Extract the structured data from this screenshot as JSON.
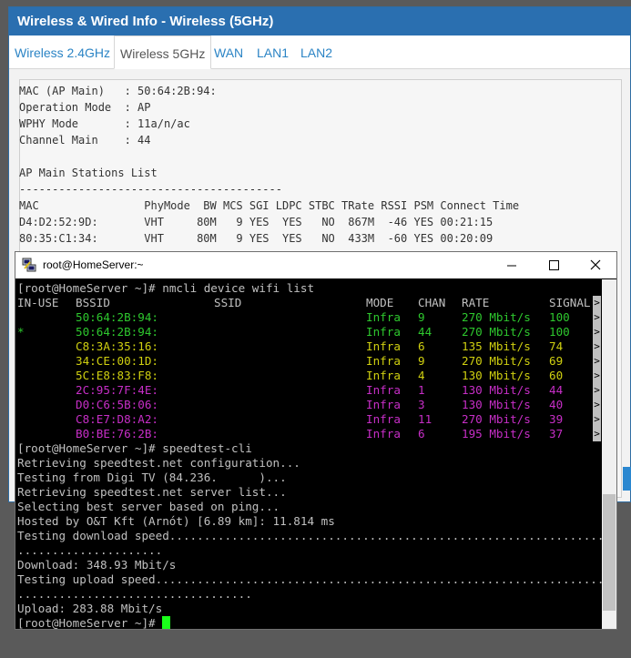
{
  "router": {
    "title": "Wireless & Wired Info - Wireless (5GHz)",
    "tabs": [
      {
        "label": "Wireless 2.4GHz"
      },
      {
        "label": "Wireless 5GHz"
      },
      {
        "label": "WAN"
      },
      {
        "label": "LAN1"
      },
      {
        "label": "LAN2"
      }
    ],
    "active_tab": "Wireless 5GHz",
    "lines": [
      "MAC (AP Main)   : 50:64:2B:94:",
      "Operation Mode  : AP",
      "WPHY Mode       : 11a/n/ac",
      "Channel Main    : 44",
      "",
      "AP Main Stations List",
      "----------------------------------------",
      "MAC                PhyMode  BW MCS SGI LDPC STBC TRate RSSI PSM Connect Time",
      "D4:D2:52:9D:       VHT     80M   9 YES  YES   NO  867M  -46 YES 00:21:15",
      "80:35:C1:34:       VHT     80M   9 YES  YES   NO  433M  -60 YES 00:20:09"
    ]
  },
  "terminal": {
    "title": "root@HomeServer:~",
    "prompt": "[root@HomeServer ~]# ",
    "command1": "nmcli device wifi list",
    "headers": {
      "inuse": "IN-USE",
      "bssid": "BSSID",
      "ssid": "SSID",
      "mode": "MODE",
      "chan": "CHAN",
      "rate": "RATE",
      "signal": "SIGNAL"
    },
    "networks": [
      {
        "inuse": "",
        "bssid": "50:64:2B:94:",
        "mode": "Infra",
        "chan": "9",
        "rate": "270 Mbit/s",
        "signal": "100",
        "color": "#2ec82e"
      },
      {
        "inuse": "*",
        "bssid": "50:64:2B:94:",
        "mode": "Infra",
        "chan": "44",
        "rate": "270 Mbit/s",
        "signal": "100",
        "color": "#2ec82e"
      },
      {
        "inuse": "",
        "bssid": "C8:3A:35:16:",
        "mode": "Infra",
        "chan": "6",
        "rate": "135 Mbit/s",
        "signal": "74",
        "color": "#d0d010"
      },
      {
        "inuse": "",
        "bssid": "34:CE:00:1D:",
        "mode": "Infra",
        "chan": "9",
        "rate": "270 Mbit/s",
        "signal": "69",
        "color": "#d0d010"
      },
      {
        "inuse": "",
        "bssid": "5C:E8:83:F8:",
        "mode": "Infra",
        "chan": "4",
        "rate": "130 Mbit/s",
        "signal": "60",
        "color": "#d0d010"
      },
      {
        "inuse": "",
        "bssid": "2C:95:7F:4E:",
        "mode": "Infra",
        "chan": "1",
        "rate": "130 Mbit/s",
        "signal": "44",
        "color": "#c72ec7"
      },
      {
        "inuse": "",
        "bssid": "D0:C6:5B:06:",
        "mode": "Infra",
        "chan": "3",
        "rate": "130 Mbit/s",
        "signal": "40",
        "color": "#c72ec7"
      },
      {
        "inuse": "",
        "bssid": "C8:E7:D8:A2:",
        "mode": "Infra",
        "chan": "11",
        "rate": "270 Mbit/s",
        "signal": "39",
        "color": "#c72ec7"
      },
      {
        "inuse": "",
        "bssid": "B0:BE:76:2B:",
        "mode": "Infra",
        "chan": "6",
        "rate": "195 Mbit/s",
        "signal": "37",
        "color": "#c72ec7"
      }
    ],
    "command2": "speedtest-cli",
    "output": [
      "Retrieving speedtest.net configuration...",
      "Testing from Digi TV (84.236.      )...",
      "Retrieving speedtest.net server list...",
      "Selecting best server based on ping...",
      "Hosted by O&T Kft (Arnót) [6.89 km]: 11.814 ms",
      "Testing download speed................................................................................",
      ".....................",
      "Download: 348.93 Mbit/s",
      "Testing upload speed..................................................................................",
      "..................................",
      "Upload: 283.88 Mbit/s"
    ],
    "final_prompt": "[root@HomeServer ~]# "
  }
}
